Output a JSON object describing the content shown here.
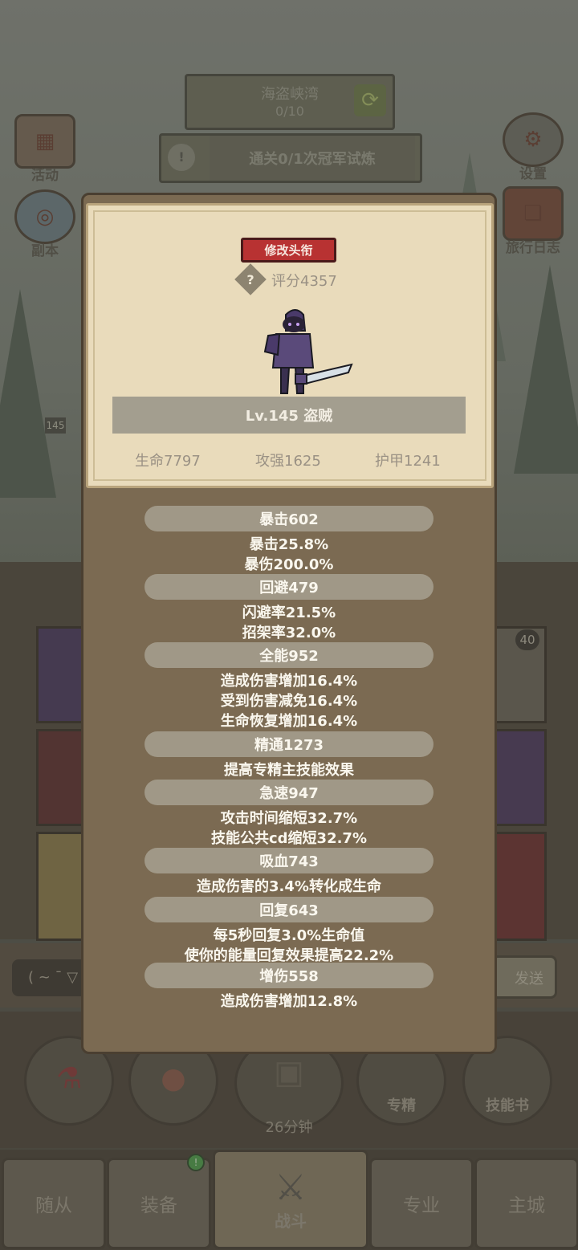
{
  "background": {
    "map_title": "海盗峡湾",
    "map_progress": "0/10",
    "quest_text": "通关0/1次冠军试炼",
    "left_buttons": [
      "活动",
      "副本"
    ],
    "right_buttons": [
      "设置",
      "旅行日志"
    ],
    "round_buttons": [
      "",
      "",
      "26分钟",
      "专精",
      "技能书"
    ],
    "tabs": [
      "随从",
      "装备",
      "战斗",
      "专业",
      "主城"
    ],
    "tab_badge": "!",
    "level_badge": "145",
    "chat_text": "( ~ ¯ ▽",
    "send_label": "发送",
    "side_count": "40"
  },
  "profile": {
    "change_title_label": "修改头衔",
    "help_icon": "?",
    "score": "评分4357",
    "level_class": "Lv.145 盗贼",
    "base_stats": [
      "生命7797",
      "攻强1625",
      "护甲1241"
    ]
  },
  "stats": [
    {
      "name": "暴击602",
      "lines": [
        "暴击25.8%",
        "暴伤200.0%"
      ]
    },
    {
      "name": "回避479",
      "lines": [
        "闪避率21.5%",
        "招架率32.0%"
      ]
    },
    {
      "name": "全能952",
      "lines": [
        "造成伤害增加16.4%",
        "受到伤害减免16.4%",
        "生命恢复增加16.4%"
      ]
    },
    {
      "name": "精通1273",
      "lines": [
        "提高专精主技能效果"
      ]
    },
    {
      "name": "急速947",
      "lines": [
        "攻击时间缩短32.7%",
        "技能公共cd缩短32.7%"
      ]
    },
    {
      "name": "吸血743",
      "lines": [
        "造成伤害的3.4%转化成生命"
      ]
    },
    {
      "name": "回复643",
      "lines": [
        "每5秒回复3.0%生命值",
        "使你的能量回复效果提高22.2%"
      ]
    },
    {
      "name": "增伤558",
      "lines": [
        "造成伤害增加12.8%"
      ]
    }
  ]
}
